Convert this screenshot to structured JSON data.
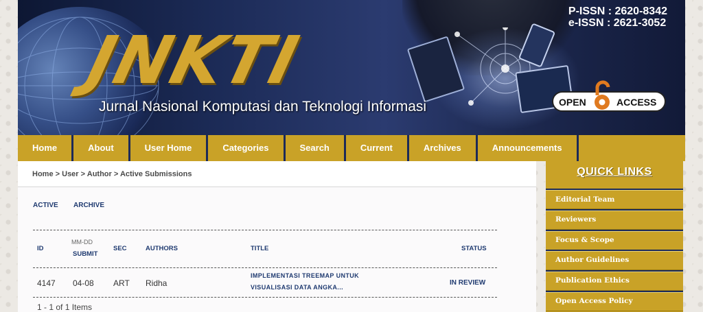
{
  "header": {
    "logo": "JNKTI",
    "subtitle": "Jurnal Nasional Komputasi dan Teknologi Informasi",
    "pissn": "P-ISSN : 2620-8342",
    "eissn": "e-ISSN : 2621-3052",
    "open_access_left": "OPEN",
    "open_access_right": "ACCESS"
  },
  "nav": [
    "Home",
    "About",
    "User Home",
    "Categories",
    "Search",
    "Current",
    "Archives",
    "Announcements"
  ],
  "breadcrumb": [
    "Home",
    "User",
    "Author",
    "Active Submissions"
  ],
  "breadcrumb_sep": ">",
  "tabs": {
    "active": "ACTIVE",
    "archive": "ARCHIVE"
  },
  "table": {
    "headers": {
      "id": "ID",
      "date_top": "MM-DD",
      "date_bottom": "SUBMIT",
      "sec": "SEC",
      "authors": "AUTHORS",
      "title": "TITLE",
      "status": "STATUS"
    },
    "rows": [
      {
        "id": "4147",
        "date": "04-08",
        "sec": "ART",
        "authors": "Ridha",
        "title_line1": "IMPLEMENTASI TREEMAP UNTUK",
        "title_line2": "VISUALISASI DATA ANGKA...",
        "status": "IN REVIEW"
      }
    ],
    "pager": "1 - 1 of 1 Items"
  },
  "sidebar": {
    "title": "QUICK LINKS",
    "items": [
      "Editorial Team",
      "Reviewers",
      "Focus & Scope",
      "Author Guidelines",
      "Publication Ethics",
      "Open Access Policy"
    ]
  },
  "colors": {
    "gold": "#c9a227",
    "navy": "#1c2a58",
    "link": "#1f3a70"
  }
}
